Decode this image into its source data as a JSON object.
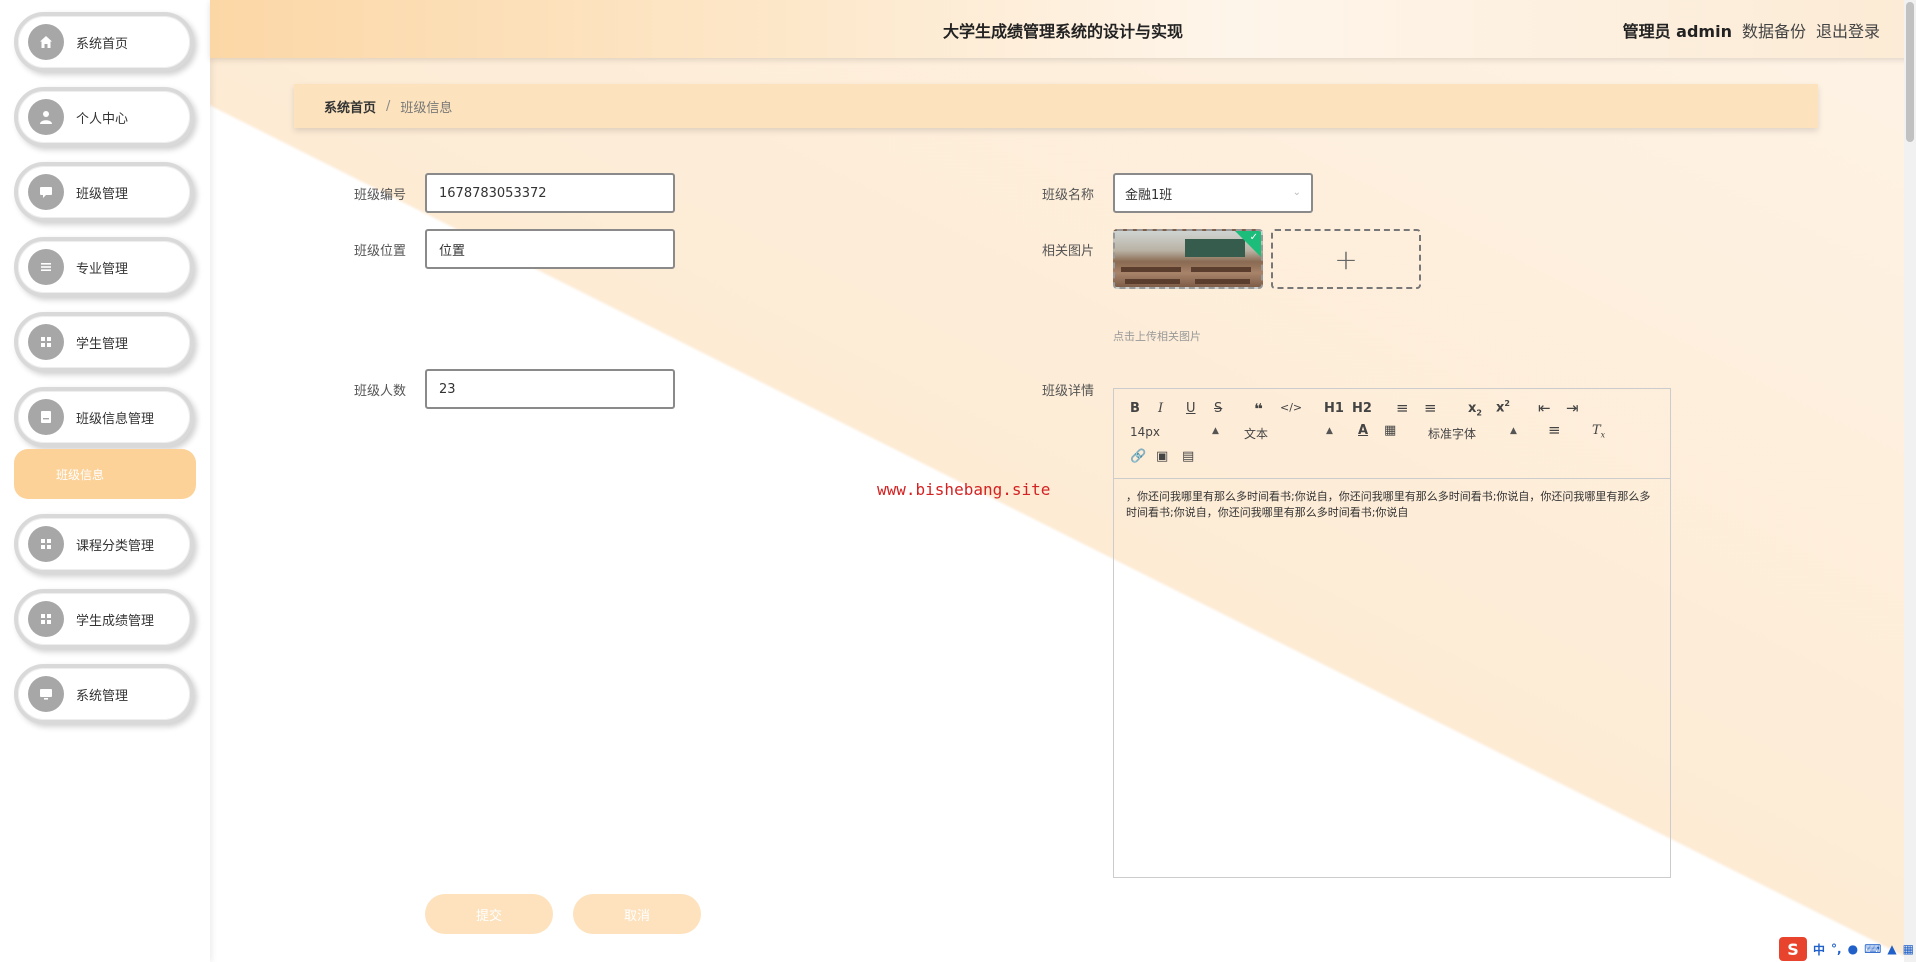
{
  "header": {
    "title": "大学生成绩管理系统的设计与实现",
    "user_label": "管理员 admin",
    "backup": "数据备份",
    "logout": "退出登录"
  },
  "sidebar": {
    "items": [
      {
        "label": "系统首页",
        "icon": "home-icon"
      },
      {
        "label": "个人中心",
        "icon": "user-icon"
      },
      {
        "label": "班级管理",
        "icon": "chat-icon"
      },
      {
        "label": "专业管理",
        "icon": "list-icon"
      },
      {
        "label": "学生管理",
        "icon": "grid-icon"
      },
      {
        "label": "班级信息管理",
        "icon": "document-icon"
      },
      {
        "label": "课程分类管理",
        "icon": "grid-icon"
      },
      {
        "label": "学生成绩管理",
        "icon": "grid-icon"
      },
      {
        "label": "系统管理",
        "icon": "monitor-icon"
      }
    ],
    "subitem": "班级信息"
  },
  "breadcrumb": {
    "home": "系统首页",
    "separator": "/",
    "current": "班级信息"
  },
  "form": {
    "class_no_label": "班级编号",
    "class_no_value": "1678783053372",
    "class_location_label": "班级位置",
    "class_location_value": "位置",
    "class_count_label": "班级人数",
    "class_count_value": "23",
    "class_name_label": "班级名称",
    "class_name_value": "金融1班",
    "image_label": "相关图片",
    "upload_hint": "点击上传相关图片",
    "detail_label": "班级详情"
  },
  "editor": {
    "font_size": "14px",
    "text_type": "文本",
    "font_family": "标准字体",
    "h1": "H1",
    "h2": "H2",
    "content": "，你还问我哪里有那么多时间看书;你说自，你还问我哪里有那么多时间看书;你说自，你还问我哪里有那么多时间看书;你说自，你还问我哪里有那么多时间看书;你说自"
  },
  "watermark": "www.bishebang.site",
  "buttons": {
    "submit": "提交",
    "cancel": "取消"
  },
  "ime": {
    "logo": "S",
    "lang": "中"
  },
  "colors": {
    "accent": "#fcd299",
    "header": "#fcd7a6",
    "watermark": "#d42222"
  }
}
